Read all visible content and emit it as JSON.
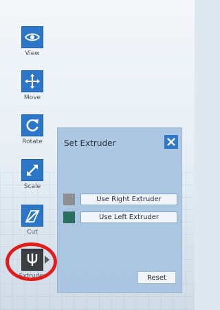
{
  "toolbar": {
    "tools": [
      {
        "label": "View",
        "icon": "eye-icon"
      },
      {
        "label": "Move",
        "icon": "move-arrows-icon"
      },
      {
        "label": "Rotate",
        "icon": "rotate-icon"
      },
      {
        "label": "Scale",
        "icon": "scale-icon"
      },
      {
        "label": "Cut",
        "icon": "cut-icon"
      },
      {
        "label": "Extruder",
        "icon": "extruder-icon"
      }
    ]
  },
  "panel": {
    "title": "Set Extruder",
    "right_button_label": "Use Right Extruder",
    "left_button_label": "Use Left Extruder",
    "reset_label": "Reset"
  },
  "colors": {
    "tool_blue": "#2b76c6",
    "tool_active": "#3a3d41",
    "right_extruder_swatch": "#8f8f8f",
    "left_extruder_swatch": "#2b6e5f",
    "highlight_ring": "#e21b1b"
  }
}
